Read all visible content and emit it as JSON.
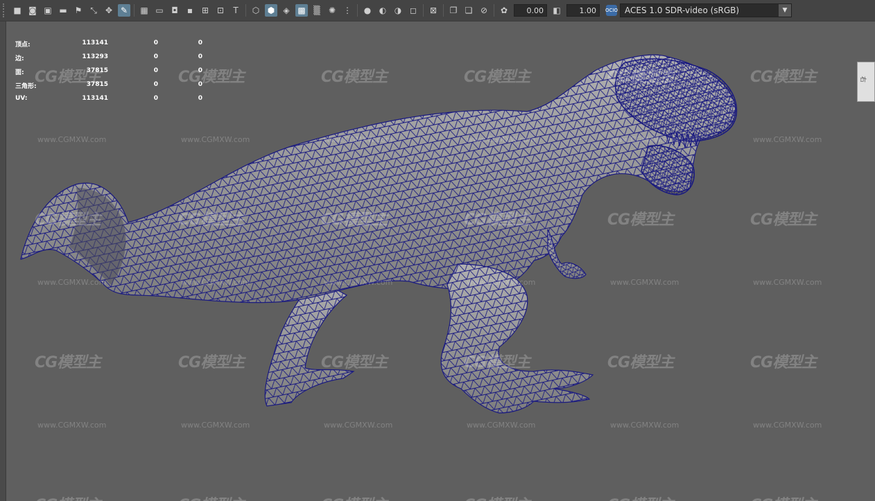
{
  "toolbar": {
    "exposure_value": "0.00",
    "gamma_value": "1.00",
    "color_space_badge": "OCIO",
    "color_space": "ACES 1.0 SDR-video (sRGB)",
    "icons": [
      "select-camera-icon",
      "camera-attributes-icon",
      "bookmark-icon",
      "image-plane-icon",
      "bookmark-flag-icon",
      "2d-pan-zoom-icon",
      "grease-pencil-icon",
      "grid-icon",
      "film-gate-icon",
      "resolution-gate-icon",
      "gate-mask-icon",
      "field-chart-icon",
      "safe-action-icon",
      "safe-title-icon",
      "wireframe-icon",
      "smooth-shade-icon",
      "default-material-icon",
      "textured-icon",
      "use-all-lights-icon",
      "shadows-icon",
      "ambient-occlusion-icon",
      "motion-blur-icon",
      "anti-aliasing-icon",
      "depth-of-field-icon",
      "isolate-select-icon",
      "xray-icon",
      "xray-joints-icon",
      "xray-components-icon",
      "exposure-icon",
      "gamma-icon",
      "color-management-icon"
    ]
  },
  "hud": {
    "rows": [
      {
        "label": "顶点:",
        "v1": "113141",
        "v2": "0",
        "v3": "0"
      },
      {
        "label": "边:",
        "v1": "113293",
        "v2": "0",
        "v3": "0"
      },
      {
        "label": "面:",
        "v1": "37815",
        "v2": "0",
        "v3": "0"
      },
      {
        "label": "三角形:",
        "v1": "37815",
        "v2": "0",
        "v3": "0"
      },
      {
        "label": "UV:",
        "v1": "113141",
        "v2": "0",
        "v3": "0"
      }
    ]
  },
  "watermark": {
    "logo": "CG模型主",
    "url": "www.CGMXW.com"
  },
  "colors": {
    "viewport_bg": "#5f5f5f",
    "wireframe": "#1a1a80",
    "model_fill": "#9a9a9a",
    "accent": "#5e7f94"
  },
  "viewcube": {
    "label": "右"
  }
}
